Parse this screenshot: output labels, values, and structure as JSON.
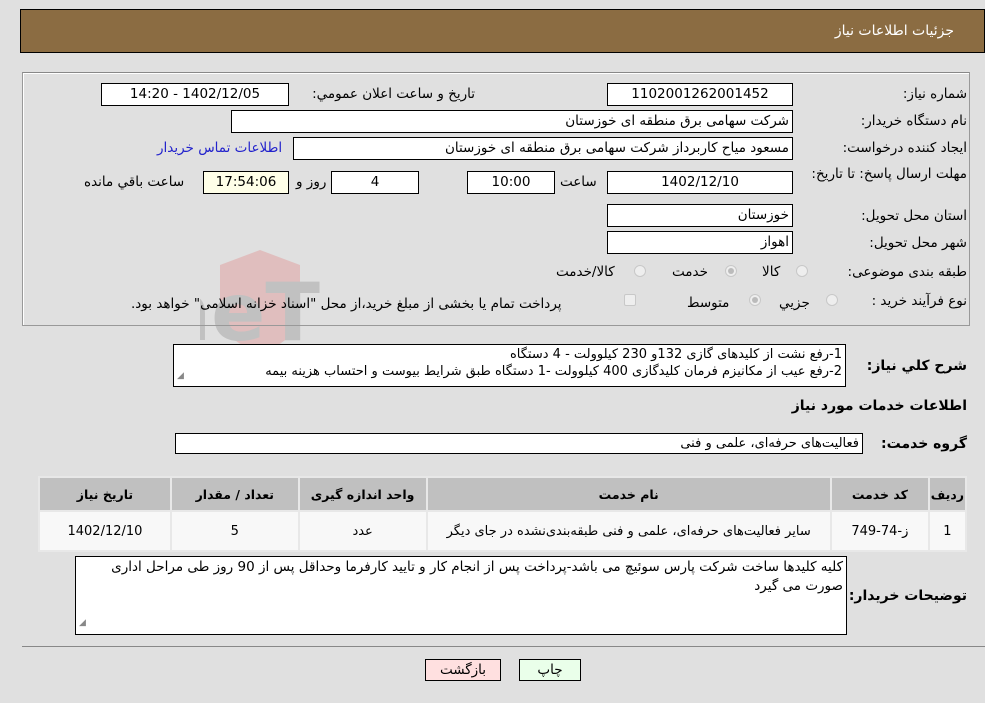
{
  "header": {
    "title": "جزئیات اطلاعات نیاز"
  },
  "form": {
    "need_number": {
      "label": "شماره نیاز:",
      "value": "1102001262001452"
    },
    "announce_datetime": {
      "label": "تاریخ و ساعت اعلان عمومي:",
      "value": "1402/12/05 - 14:20"
    },
    "buyer_org": {
      "label": "نام دستگاه خريدار:",
      "value": "شرکت سهامی برق منطقه ای خوزستان"
    },
    "requester": {
      "label": "ایجاد کننده درخواست:",
      "value": "مسعود میاح کاربرداز شرکت سهامی برق منطقه ای خوزستان"
    },
    "buyer_contact_link": "اطلاعات تماس خریدار",
    "deadline": {
      "label": "مهلت ارسال پاسخ: تا تاریخ:",
      "date": "1402/12/10",
      "time_label": "ساعت",
      "time": "10:00",
      "days": "4",
      "days_label": "روز و",
      "remaining": "17:54:06",
      "remaining_label": "ساعت باقي مانده"
    },
    "province": {
      "label": "استان محل تحویل:",
      "value": "خوزستان"
    },
    "city": {
      "label": "شهر محل تحویل:",
      "value": "اهواز"
    },
    "category": {
      "label": "طبقه بندی موضوعی:",
      "options": [
        "کالا",
        "خدمت",
        "کالا/خدمت"
      ],
      "selected": "خدمت"
    },
    "purchase_type": {
      "label": "نوع فرآیند خرید :",
      "options": [
        "جزيي",
        "متوسط"
      ],
      "selected": "متوسط",
      "treasury_note": "پرداخت تمام یا بخشی از مبلغ خرید،از محل \"اسناد خزانه اسلامی\" خواهد بود."
    }
  },
  "summary": {
    "label": "شرح کلي نیاز:",
    "lines": [
      "1-رفع نشت از کلیدهای گازی 132و 230 کیلوولت - 4 دستگاه",
      "2-رفع عیب از مکانیزم فرمان کلیدگازی 400 کیلوولت -1 دستگاه طبق شرایط بیوست و احتساب هزینه بیمه"
    ]
  },
  "services_section": {
    "title": "اطلاعات خدمات مورد نیاز",
    "group_label": "گروه خدمت:",
    "group_value": "فعالیت‌های حرفه‌ای، علمی و فنی"
  },
  "table": {
    "headers": [
      "ردیف",
      "کد خدمت",
      "نام خدمت",
      "واحد اندازه گیری",
      "تعداد / مقدار",
      "تاریخ نیاز"
    ],
    "rows": [
      [
        "1",
        "ز-74-749",
        "سایر فعالیت‌های حرفه‌ای، علمی و فنی طبقه‌بندی‌نشده در جای دیگر",
        "عدد",
        "5",
        "1402/12/10"
      ]
    ]
  },
  "buyer_notes": {
    "label": "توضیحات خریدار:",
    "value": "کلیه کلیدها ساخت شرکت پارس سوئیچ می باشد-پرداخت پس از انجام کار و تایید کارفرما وحداقل پس از 90 روز طی مراحل اداری صورت می گیرد"
  },
  "buttons": {
    "print": "چاپ",
    "back": "بازگشت"
  },
  "colors": {
    "header_bg": "#8b6c42",
    "print_bg": "#eaffea",
    "back_bg": "#ffe0e0",
    "link": "#2222cc"
  }
}
